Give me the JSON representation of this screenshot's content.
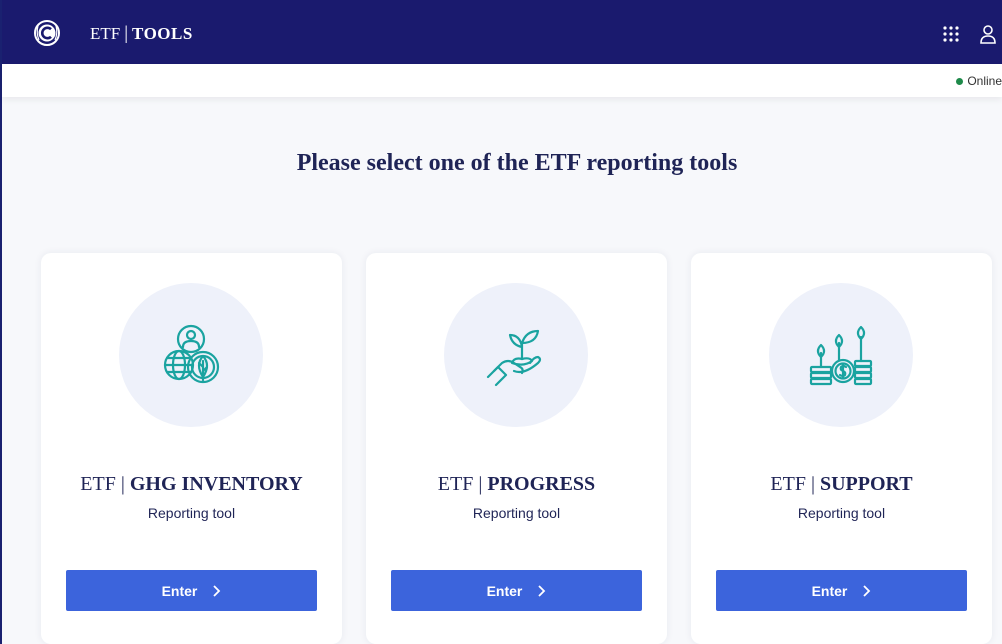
{
  "header": {
    "brand_prefix": "ETF",
    "brand_separator": "|",
    "brand_name": "TOOLS",
    "logo_icon": "unfccc-logo-icon",
    "apps_icon": "apps-grid-icon",
    "user_icon": "user-icon",
    "background": "#1a1a6e"
  },
  "status": {
    "label": "Online",
    "color": "#1e8a4a"
  },
  "main": {
    "heading": "Please select one of the ETF reporting tools"
  },
  "cards": [
    {
      "prefix": "ETF",
      "separator": "|",
      "name": "GHG INVENTORY",
      "subtitle": "Reporting tool",
      "button_label": "Enter",
      "icon": "people-globe-leaf-icon"
    },
    {
      "prefix": "ETF",
      "separator": "|",
      "name": "PROGRESS",
      "subtitle": "Reporting tool",
      "button_label": "Enter",
      "icon": "hand-sprout-icon"
    },
    {
      "prefix": "ETF",
      "separator": "|",
      "name": "SUPPORT",
      "subtitle": "Reporting tool",
      "button_label": "Enter",
      "icon": "coins-plants-icon"
    }
  ],
  "colors": {
    "accent": "#3c64dc",
    "icon": "#1aa3a0",
    "text": "#1f2456"
  }
}
